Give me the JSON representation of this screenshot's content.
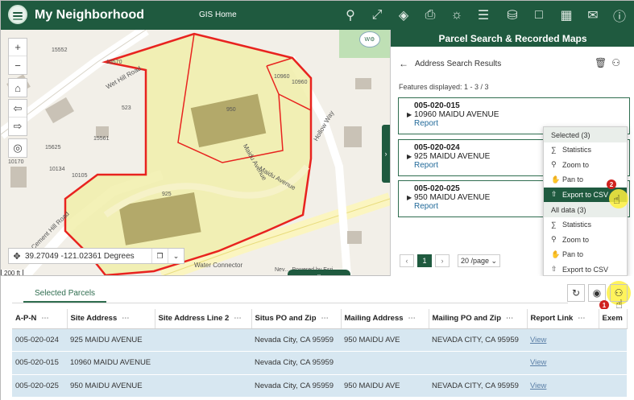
{
  "header": {
    "app_title": "My Neighborhood",
    "subtitle": "GIS Home",
    "tools": [
      "search-icon",
      "select-icon",
      "layers-icon",
      "print-icon",
      "basemap-icon",
      "measure-icon",
      "database-icon",
      "bookmark-icon",
      "grid-icon",
      "mail-icon",
      "info-icon"
    ]
  },
  "map": {
    "zoom_in": "+",
    "zoom_out": "−",
    "parcel_labels": [
      "15552",
      "15570",
      "523",
      "15561",
      "15625",
      "10170",
      "10134",
      "10105",
      "10960",
      "10960",
      "950",
      "925"
    ],
    "street_labels": [
      "Wet Hill Road",
      "Hollow Way",
      "Maidu Avenue",
      "Maidu Avenue",
      "Cement Hill Road",
      "Water Connector"
    ],
    "coordinates": "39.27049 -121.02361 Degrees",
    "scale": "200 ft",
    "attribution": "Nev… Powered by Esri",
    "watermark_text": "W"
  },
  "panel": {
    "title": "Parcel Search & Recorded Maps",
    "results_title": "Address Search Results",
    "features_label": "Features displayed: 1 - 3 / 3",
    "link_label": "Report",
    "results": [
      {
        "apn": "005-020-015",
        "address": "10960 MAIDU AVENUE"
      },
      {
        "apn": "005-020-024",
        "address": "925 MAIDU AVENUE"
      },
      {
        "apn": "005-020-025",
        "address": "950 MAIDU AVENUE"
      }
    ],
    "pager": {
      "current": "1",
      "per_page": "20 /page"
    }
  },
  "menu": {
    "selected_header": "Selected (3)",
    "selected_items": [
      "Statistics",
      "Zoom to",
      "Pan to",
      "Export to CSV"
    ],
    "all_header": "All data (3)",
    "all_items": [
      "Statistics",
      "Zoom to",
      "Pan to",
      "Export to CSV"
    ],
    "step_badge": "2"
  },
  "table": {
    "tab_label": "Selected Parcels",
    "step_badge": "1",
    "columns": [
      "A-P-N",
      "Site Address",
      "Site Address Line 2",
      "Situs PO and Zip",
      "Mailing Address",
      "Mailing PO and Zip",
      "Report Link",
      "Exem"
    ],
    "rows": [
      [
        "005-020-024",
        "925 MAIDU AVENUE",
        "",
        "Nevada City, CA 95959",
        "950 MAIDU AVE",
        "NEVADA CITY, CA 95959",
        "View",
        ""
      ],
      [
        "005-020-015",
        "10960 MAIDU AVENUE",
        "",
        "Nevada City, CA 95959",
        "",
        "",
        "View",
        ""
      ],
      [
        "005-020-025",
        "950 MAIDU AVENUE",
        "",
        "Nevada City, CA 95959",
        "950 MAIDU AVE",
        "NEVADA CITY, CA 95959",
        "View",
        ""
      ]
    ]
  },
  "colors": {
    "brand_green": "#1f5a3f",
    "selection_red": "#e8231f",
    "parcel_fill": "#f1efaa",
    "row_highlight": "#d7e7f1"
  }
}
